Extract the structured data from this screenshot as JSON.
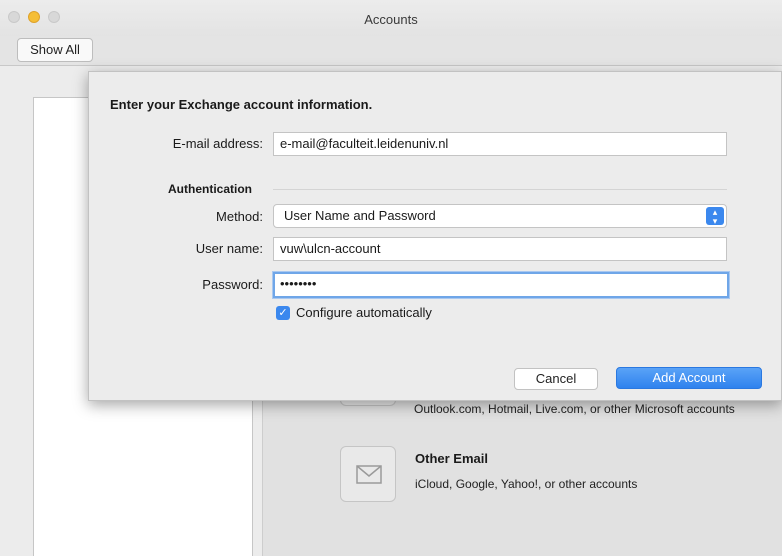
{
  "window": {
    "title": "Accounts"
  },
  "toolbar": {
    "show_all": "Show All"
  },
  "sheet": {
    "heading": "Enter your Exchange account information.",
    "email_label": "E-mail address:",
    "email_value": "e-mail@faculteit.leidenuniv.nl",
    "auth_section": "Authentication",
    "method_label": "Method:",
    "method_value": "User Name and Password",
    "username_label": "User name:",
    "username_value": "vuw\\ulcn-account",
    "password_label": "Password:",
    "password_value": "••••••••",
    "configure_label": "Configure automatically",
    "cancel": "Cancel",
    "add_account": "Add Account"
  },
  "options": {
    "outlook_desc": "Outlook.com, Hotmail, Live.com, or other Microsoft accounts",
    "other_title": "Other Email",
    "other_desc": "iCloud, Google, Yahoo!, or other accounts"
  },
  "icons": {
    "outlook": "outlook-icon",
    "mail": "envelope-icon",
    "check": "checkmark-icon",
    "select": "chevron-updown-icon"
  },
  "colors": {
    "accent": "#3b88ee",
    "minimize": "#f5be36"
  }
}
